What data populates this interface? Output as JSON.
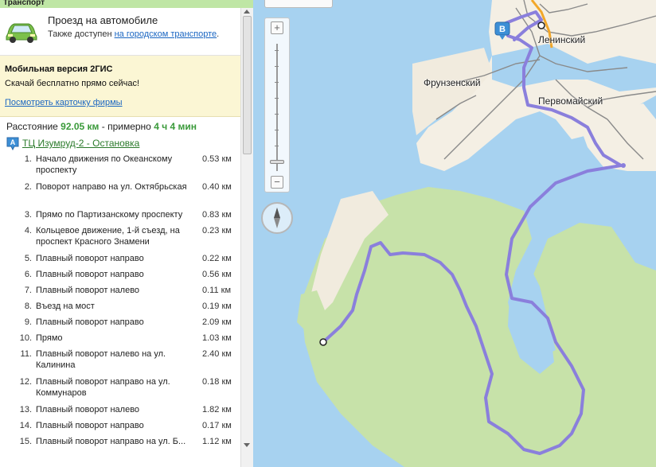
{
  "panel": {
    "title": "Транспорт",
    "car": {
      "title": "Проезд на автомобиле",
      "sub_prefix": "Также доступен ",
      "sub_link": "на городском транспорте",
      "sub_suffix": "."
    },
    "promo": {
      "title": "Мобильная версия 2ГИС",
      "text": "Скачай бесплатно прямо сейчас!",
      "link": "Посмотреть карточку фирмы"
    },
    "summary": {
      "label": "Расстояние ",
      "distance": "92.05 км",
      "mid": " - примерно ",
      "time": "4 ч 4 мин"
    },
    "destination": {
      "icon": "location-marker-icon",
      "badge": "A",
      "label": "ТЦ Изумруд-2 - Остановка"
    },
    "steps": [
      {
        "n": "1.",
        "text": "Начало движения по Океанскому проспекту",
        "km": "0.53 км"
      },
      {
        "n": "2.",
        "text": "Поворот направо на ул. Октябрьская",
        "km": "0.40 км"
      },
      {
        "n": "3.",
        "text": "Прямо по Партизанскому проспекту",
        "km": "0.83 км"
      },
      {
        "n": "4.",
        "text": "Кольцевое движение, 1-й съезд, на проспект Красного Знамени",
        "km": "0.23 км"
      },
      {
        "n": "5.",
        "text": "Плавный поворот направо",
        "km": "0.22 км"
      },
      {
        "n": "6.",
        "text": "Плавный поворот направо",
        "km": "0.56 км"
      },
      {
        "n": "7.",
        "text": "Плавный поворот налево",
        "km": "0.11 км"
      },
      {
        "n": "8.",
        "text": "Въезд на мост",
        "km": "0.19 км"
      },
      {
        "n": "9.",
        "text": "Плавный поворот направо",
        "km": "2.09 км"
      },
      {
        "n": "10.",
        "text": "Прямо",
        "km": "1.03 км"
      },
      {
        "n": "11.",
        "text": "Плавный поворот налево на ул. Калинина",
        "km": "2.40 км"
      },
      {
        "n": "12.",
        "text": "Плавный поворот направо на ул. Коммунаров",
        "km": "0.18 км"
      },
      {
        "n": "13.",
        "text": "Плавный поворот налево",
        "km": "1.82 км"
      },
      {
        "n": "14.",
        "text": "Плавный поворот направо",
        "km": "0.17 км"
      },
      {
        "n": "15.",
        "text": "Плавный поворот направо на ул. Б...",
        "km": "1.12 км"
      }
    ]
  },
  "map": {
    "places": {
      "leninsky": "Ленинский",
      "frunzensky": "Фрунзенский",
      "pervomaisky": "Первомайский"
    },
    "start_badge": "B",
    "zoom_in": "+",
    "zoom_out": "−",
    "colors": {
      "water": "#a7d2f0",
      "land": "#f4efe4",
      "forest": "#c7e2a9",
      "route": "#8a7fdc",
      "road": "#8a8a8a",
      "highway": "#f2a72a"
    }
  }
}
